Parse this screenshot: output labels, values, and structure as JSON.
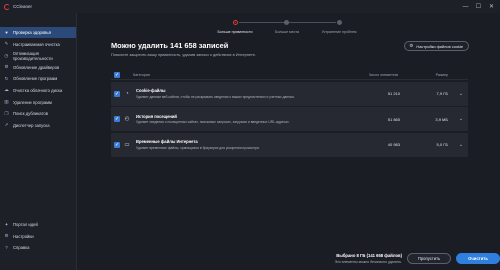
{
  "app": {
    "name": "CCleaner"
  },
  "window": {
    "minimize": "—",
    "maximize": "☐",
    "close": "✕"
  },
  "sidebar": {
    "items": [
      {
        "label": "Проверка здоровья",
        "icon": "heart-icon",
        "glyph": "♥",
        "active": true
      },
      {
        "label": "Настраиваемая очистка",
        "icon": "broom-icon",
        "glyph": "✎"
      },
      {
        "label": "Оптимизация производительности",
        "icon": "speed-icon",
        "glyph": "◷"
      },
      {
        "label": "Обновление драйверов",
        "icon": "gear-icon",
        "glyph": "⚙"
      },
      {
        "label": "Обновление программ",
        "icon": "refresh-icon",
        "glyph": "↻"
      },
      {
        "label": "Очистка облачного диска",
        "icon": "cloud-icon",
        "glyph": "☁"
      },
      {
        "label": "Удаление программ",
        "icon": "trash-icon",
        "glyph": "🗑"
      },
      {
        "label": "Поиск дубликатов",
        "icon": "copy-icon",
        "glyph": "❐"
      },
      {
        "label": "Диспетчер запуска",
        "icon": "rocket-icon",
        "glyph": "➚"
      }
    ],
    "bottom_items": [
      {
        "label": "Портал идей",
        "icon": "bulb-icon",
        "glyph": "✦"
      },
      {
        "label": "Настройки",
        "icon": "settings-icon",
        "glyph": "⚙"
      },
      {
        "label": "Справка",
        "icon": "help-icon",
        "glyph": "?"
      }
    ]
  },
  "stepper": {
    "steps": [
      {
        "label": "Больше приватности",
        "active": true
      },
      {
        "label": "Больше места"
      },
      {
        "label": "Устранение проблем"
      }
    ]
  },
  "main": {
    "title": "Можно удалить 141 658 записей",
    "subtitle": "Помогите защитить вашу приватность, удалив записи о действиях в Интернете.",
    "settings_button": "Настройки файлов cookie"
  },
  "table": {
    "headers": {
      "category": "Категория",
      "count": "Число элементов",
      "size": "Размер"
    },
    "rows": [
      {
        "title": "Cookie-файлы",
        "desc": "Удаляет данные веб-сайтов, чтобы не раскрывать сведения о ваших предпочтениях и учетных данных.",
        "count": "51 210",
        "size": "7,9 ГБ",
        "icon": "cookie-icon",
        "glyph": "◔"
      },
      {
        "title": "История посещений",
        "desc": "Удаляет сведения о посещенных сайтах, поисковых запросах, загрузках и введенных URL-адресах.",
        "count": "51 865",
        "size": "3,9 МБ",
        "icon": "history-icon",
        "glyph": "◴"
      },
      {
        "title": "Временные файлы Интернета",
        "desc": "Удаляет временные файлы, хранящиеся в браузерах для ускорения просмотра.",
        "count": "40 983",
        "size": "5,0 ГБ",
        "icon": "file-icon",
        "glyph": "▭"
      }
    ]
  },
  "footer": {
    "selected": "Выбрано 8 ГБ (141 658 файлов)",
    "note": "Эти элементы можно безопасно удалить.",
    "skip": "Пропустить",
    "clean": "Очистить"
  },
  "colors": {
    "accent": "#2f7fe0",
    "brand": "#e23c3c",
    "active_nav": "#2b4a7a"
  }
}
